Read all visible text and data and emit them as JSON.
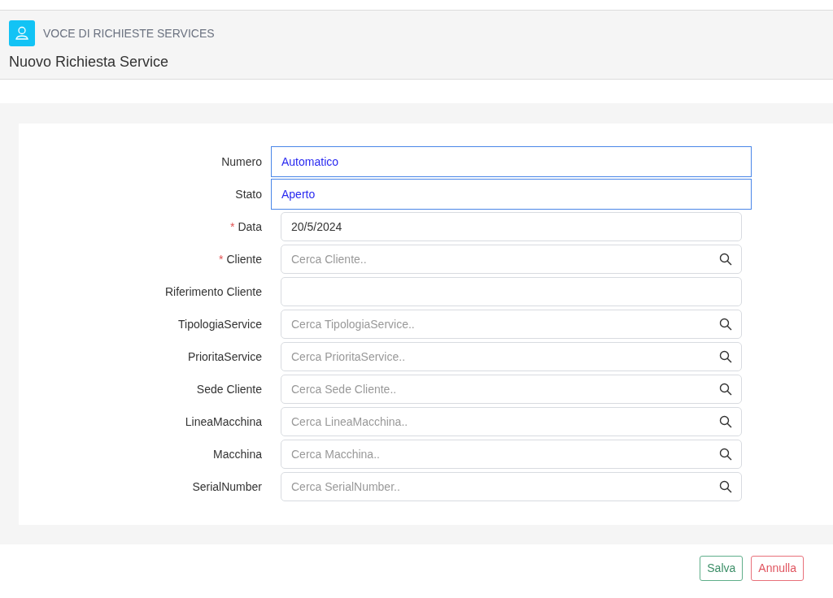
{
  "header": {
    "section": "VOCE DI RICHIESTE SERVICES",
    "title": "Nuovo Richiesta Service"
  },
  "fields": [
    {
      "label": "Numero",
      "kind": "readonly",
      "required": false,
      "value": "Automatico"
    },
    {
      "label": "Stato",
      "kind": "readonly",
      "required": false,
      "value": "Aperto"
    },
    {
      "label": "Data",
      "kind": "text",
      "required": true,
      "value": "20/5/2024"
    },
    {
      "label": "Cliente",
      "kind": "search",
      "required": true,
      "placeholder": "Cerca Cliente.."
    },
    {
      "label": "Riferimento Cliente",
      "kind": "text",
      "required": false
    },
    {
      "label": "TipologiaService",
      "kind": "search",
      "required": false,
      "placeholder": "Cerca TipologiaService.."
    },
    {
      "label": "PrioritaService",
      "kind": "search",
      "required": false,
      "placeholder": "Cerca PrioritaService.."
    },
    {
      "label": "Sede Cliente",
      "kind": "search",
      "required": false,
      "placeholder": "Cerca Sede Cliente.."
    },
    {
      "label": "LineaMacchina",
      "kind": "search",
      "required": false,
      "placeholder": "Cerca LineaMacchina.."
    },
    {
      "label": "Macchina",
      "kind": "search",
      "required": false,
      "placeholder": "Cerca Macchina.."
    },
    {
      "label": "SerialNumber",
      "kind": "search",
      "required": false,
      "placeholder": "Cerca SerialNumber.."
    }
  ],
  "required_mark": "*",
  "buttons": [
    {
      "label": "Salva",
      "kind": "confirm"
    },
    {
      "label": "Annulla",
      "kind": "cancel"
    }
  ]
}
